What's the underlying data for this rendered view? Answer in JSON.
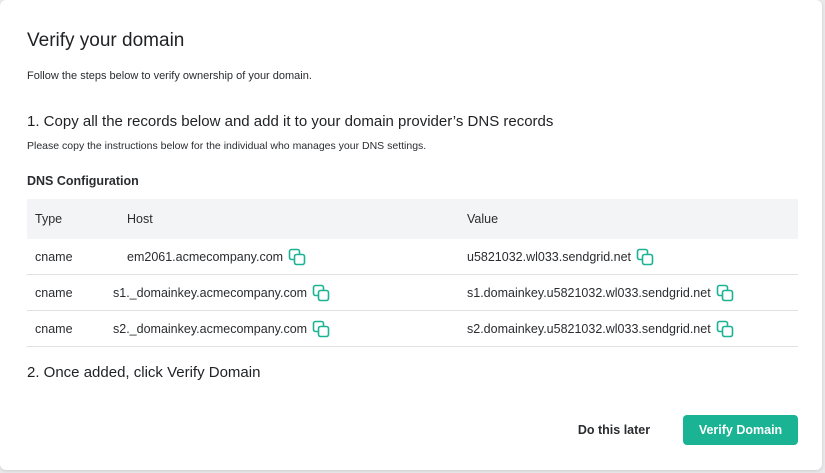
{
  "dialog": {
    "title": "Verify your domain",
    "intro": "Follow the steps below to verify ownership of your domain.",
    "step1_title": "1. Copy all the records below and add it to your domain provider’s DNS records",
    "step1_subtitle": "Please copy the instructions below for the individual who manages your DNS settings.",
    "dns_heading": "DNS Configuration",
    "step2_title": "2. Once added, click Verify Domain"
  },
  "table": {
    "headers": [
      "Type",
      "Host",
      "Value"
    ],
    "rows": [
      {
        "type": "cname",
        "host": "em2061.acmecompany.com",
        "value": "u5821032.wl033.sendgrid.net"
      },
      {
        "type": "cname",
        "host": "s1._domainkey.acmecompany.com",
        "value": "s1.domainkey.u5821032.wl033.sendgrid.net"
      },
      {
        "type": "cname",
        "host": "s2._domainkey.acmecompany.com",
        "value": "s2.domainkey.u5821032.wl033.sendgrid.net"
      }
    ]
  },
  "buttons": {
    "later": "Do this later",
    "verify": "Verify Domain"
  },
  "colors": {
    "accent": "#1ab394",
    "copy_icon": "#1ab394"
  },
  "icons": {
    "copy": "copy-icon"
  }
}
